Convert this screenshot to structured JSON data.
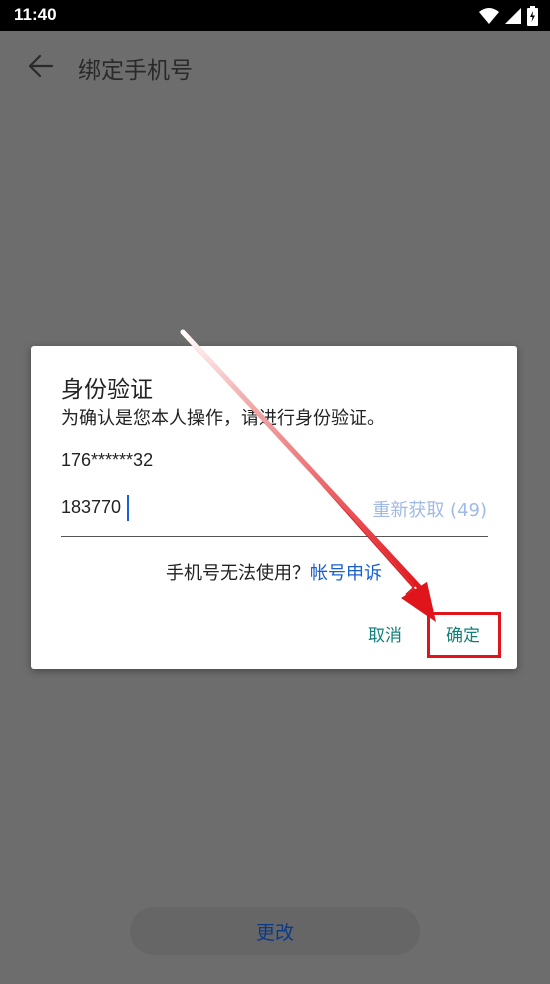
{
  "status_bar": {
    "time": "11:40",
    "icons": [
      "wifi-icon",
      "signal-icon",
      "battery-icon"
    ]
  },
  "app_bar": {
    "title": "绑定手机号",
    "back_icon": "arrow-left-icon"
  },
  "dialog": {
    "title": "身份验证",
    "subtitle": "为确认是您本人操作，请进行身份验证。",
    "masked_phone": "176******32",
    "code_value": "183770",
    "resend_label": "重新获取 (49)",
    "help_text": "手机号无法使用？",
    "help_link": "帐号申诉",
    "cancel_label": "取消",
    "confirm_label": "确定"
  },
  "bottom_button": {
    "label": "更改"
  },
  "colors": {
    "overlay": "#6d6d6d",
    "accent_teal": "#0f7f78",
    "link_blue": "#1a5fd0",
    "resend_disabled": "#9fb9e8",
    "annotation_red": "#e0151b"
  }
}
